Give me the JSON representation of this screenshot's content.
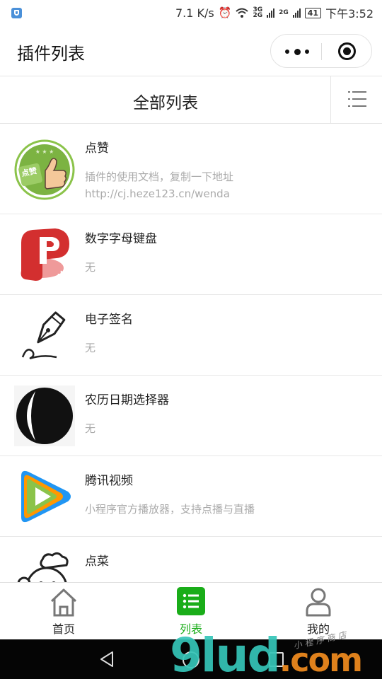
{
  "status_bar": {
    "speed": "7.1 K/s",
    "net_a_top": "3G",
    "net_a_bottom": "2G",
    "net_b": "2G",
    "battery": "41",
    "time": "下午3:52"
  },
  "nav": {
    "title": "插件列表"
  },
  "section": {
    "title": "全部列表"
  },
  "items": [
    {
      "name": "点赞",
      "desc": "插件的使用文档，复制一下地址",
      "url": "http://cj.heze123.cn/wenda",
      "icon": "thumbs-up-icon",
      "icon_text": "点赞"
    },
    {
      "name": "数字字母键盘",
      "desc": "无",
      "url": "",
      "icon": "p-keyboard-icon",
      "icon_text": "P"
    },
    {
      "name": "电子签名",
      "desc": "无",
      "url": "",
      "icon": "fountain-pen-icon",
      "icon_text": ""
    },
    {
      "name": "农历日期选择器",
      "desc": "无",
      "url": "",
      "icon": "crescent-moon-icon",
      "icon_text": ""
    },
    {
      "name": "腾讯视频",
      "desc": "小程序官方播放器，支持点播与直播",
      "url": "",
      "icon": "tencent-video-icon",
      "icon_text": ""
    },
    {
      "name": "点菜",
      "desc": "",
      "url": "",
      "icon": "chef-icon",
      "icon_text": ""
    }
  ],
  "tabs": [
    {
      "label": "首页",
      "icon": "home-icon",
      "active": false
    },
    {
      "label": "列表",
      "icon": "list-icon",
      "active": true
    },
    {
      "label": "我的",
      "icon": "user-icon",
      "active": false
    }
  ],
  "watermark": {
    "main": "9lud",
    "suffix": ".com",
    "small": "小程序商店"
  },
  "colors": {
    "accent": "#1aad19",
    "text": "#222222",
    "muted": "#aaaaaa",
    "divider": "#e5e5e5"
  }
}
